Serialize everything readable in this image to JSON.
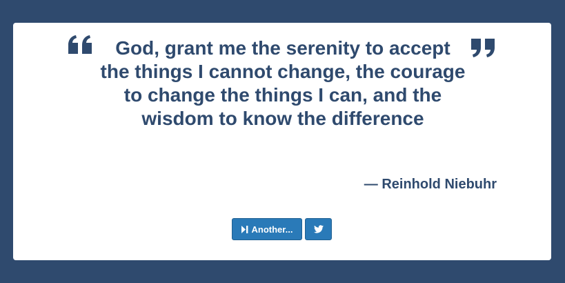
{
  "quote": {
    "text": "God, grant me the serenity to accept the things I cannot change, the courage to change the things I can, and the wisdom to know the difference",
    "author": "— Reinhold Niebuhr"
  },
  "buttons": {
    "another_label": "Another...",
    "another_icon": "skip-forward-icon",
    "tweet_icon": "twitter-icon"
  },
  "colors": {
    "background": "#2f4a6e",
    "card": "#ffffff",
    "text": "#2f4a6e",
    "button": "#2a7ab8"
  }
}
